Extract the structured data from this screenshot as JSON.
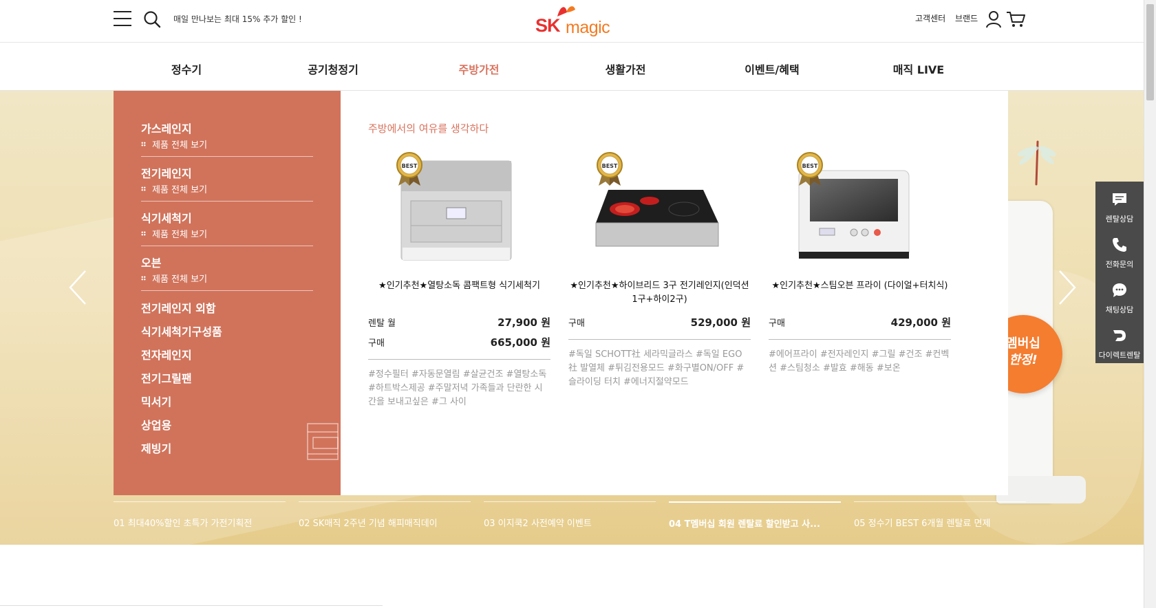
{
  "header": {
    "promo_text": "매일 만나보는 최대 15% 추가 할인 !",
    "logo_sk": "SK",
    "logo_magic": "magic",
    "customer_center": "고객센터",
    "brand": "브랜드"
  },
  "gnb": {
    "items": [
      {
        "label": "정수기"
      },
      {
        "label": "공기청정기"
      },
      {
        "label": "주방가전"
      },
      {
        "label": "생활가전"
      },
      {
        "label": "이벤트/혜택"
      },
      {
        "label": "매직 LIVE"
      }
    ],
    "active": "주방가전"
  },
  "mega_menu": {
    "categories_with_sub": [
      {
        "title": "가스레인지",
        "sub": "제품 전체 보기"
      },
      {
        "title": "전기레인지",
        "sub": "제품 전체 보기"
      },
      {
        "title": "식기세척기",
        "sub": "제품 전체 보기"
      },
      {
        "title": "오븐",
        "sub": "제품 전체 보기"
      }
    ],
    "categories_simple": [
      "전기레인지 외함",
      "식기세척기구성품",
      "전자레인지",
      "전기그릴팬",
      "믹서기",
      "상업용",
      "제빙기"
    ],
    "heading": "주방에서의 여유를 생각하다",
    "products": [
      {
        "name": "★인기추천★열탕소독 콤팩트형 식기세척기",
        "prices": [
          {
            "label": "렌탈 월",
            "value": "27,900 원"
          },
          {
            "label": "구매",
            "value": "665,000 원"
          }
        ],
        "tags": "#정수필터 #자동문열림 #살균건조 #열탕소독 #하트박스제공 #주말저녁 가족들과 단란한 시간을 보내고싶은 #그 사이",
        "badge": "BEST"
      },
      {
        "name": "★인기추천★하이브리드 3구 전기레인지(인덕션1구+하이2구)",
        "prices": [
          {
            "label": "구매",
            "value": "529,000 원"
          }
        ],
        "tags": "#독일 SCHOTT社 세라믹글라스 #독일 EGO社 발열체 #튀김전용모드 #화구별ON/OFF #슬라이딩 터치 #에너지절약모드",
        "badge": "BEST"
      },
      {
        "name": "★인기추천★스팀오븐 프라이 (다이얼+터치식)",
        "prices": [
          {
            "label": "구매",
            "value": "429,000 원"
          }
        ],
        "tags": "#에어프라이 #전자레인지 #그릴 #건조 #컨벡션 #스팀청소 #발효 #해동 #보온",
        "badge": "BEST"
      }
    ]
  },
  "hero": {
    "membership_line1": "멤버십",
    "membership_line2": "한정!"
  },
  "tabs": [
    {
      "label": "01 최대40%할인 초특가 가전기획전"
    },
    {
      "label": "02 SK매직 2주년 기념 해피매직데이"
    },
    {
      "label": "03 이지쿡2 사전예약 이벤트"
    },
    {
      "label": "04 T멤버십 회원 렌탈료 할인받고 사..."
    },
    {
      "label": "05 정수기 BEST 6개월 렌탈료 면제"
    }
  ],
  "active_tab": "04 T멤버십 회원 렌탈료 할인받고 사...",
  "quick_menu": [
    {
      "label": "렌탈상담",
      "icon": "chat-square-icon"
    },
    {
      "label": "전화문의",
      "icon": "phone-icon"
    },
    {
      "label": "채팅상담",
      "icon": "chat-bubble-icon"
    },
    {
      "label": "다이렉트렌탈",
      "icon": "direct-rental-icon"
    }
  ],
  "colors": {
    "accent": "#d1735b",
    "logo_red": "#e8312f",
    "logo_orange": "#f47a20",
    "membership": "#f47d30",
    "quick_bg": "#4a4a4a"
  }
}
